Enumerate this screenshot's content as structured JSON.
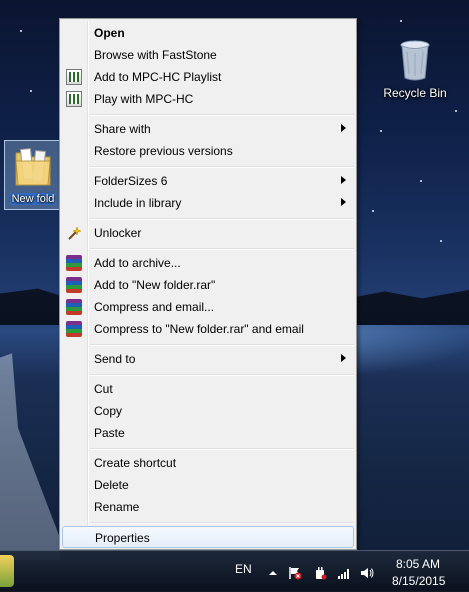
{
  "desktop": {
    "recycle_bin_label": "Recycle Bin",
    "new_folder_label": "New fold"
  },
  "menu": {
    "items": [
      {
        "label": "Open",
        "bold": true
      },
      {
        "label": "Browse with FastStone"
      },
      {
        "label": "Add to MPC-HC Playlist",
        "icon": "mpc-hc-icon"
      },
      {
        "label": "Play with MPC-HC",
        "icon": "mpc-hc-icon"
      },
      {
        "label": "Share with",
        "submenu": true
      },
      {
        "label": "Restore previous versions"
      },
      {
        "label": "FolderSizes 6",
        "submenu": true
      },
      {
        "label": "Include in library",
        "submenu": true
      },
      {
        "label": "Unlocker",
        "icon": "unlocker-wand-icon"
      },
      {
        "label": "Add to archive...",
        "icon": "winrar-icon"
      },
      {
        "label": "Add to \"New folder.rar\"",
        "icon": "winrar-icon"
      },
      {
        "label": "Compress and email...",
        "icon": "winrar-icon"
      },
      {
        "label": "Compress to \"New folder.rar\" and email",
        "icon": "winrar-icon"
      },
      {
        "label": "Send to",
        "submenu": true
      },
      {
        "label": "Cut"
      },
      {
        "label": "Copy"
      },
      {
        "label": "Paste"
      },
      {
        "label": "Create shortcut"
      },
      {
        "label": "Delete"
      },
      {
        "label": "Rename"
      },
      {
        "label": "Properties",
        "highlighted": true
      }
    ]
  },
  "taskbar": {
    "language": "EN",
    "time": "8:05 AM",
    "date": "8/15/2015",
    "tray_icons": [
      "show-hidden-icons-chevron",
      "action-center-flag-icon",
      "power-icon",
      "network-signal-icon",
      "volume-icon"
    ]
  }
}
